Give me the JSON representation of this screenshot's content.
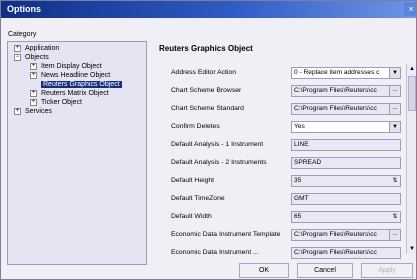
{
  "window": {
    "title": "Options",
    "close_label": "×"
  },
  "category": {
    "label": "Category",
    "tree": [
      {
        "label": "Application",
        "expander": "+"
      },
      {
        "label": "Objects",
        "expander": "−"
      },
      {
        "label": "Item Display Object",
        "expander": "+"
      },
      {
        "label": "News Headline Object",
        "expander": "+"
      },
      {
        "label": "Reuters Graphics Object",
        "selected": true
      },
      {
        "label": "Reuters Matrix Object",
        "expander": "+"
      },
      {
        "label": "Ticker Object",
        "expander": "+"
      },
      {
        "label": "Services",
        "expander": "+"
      }
    ]
  },
  "panel": {
    "title": "Reuters Graphics Object",
    "rows": [
      {
        "label": "Address Editor Action",
        "value": "0 - Replace item addresses c",
        "control": "dropdown"
      },
      {
        "label": "Chart Scheme Browser",
        "value": "C:\\Program Files\\Reuters\\cc",
        "control": "browse"
      },
      {
        "label": "Chart Scheme Standard",
        "value": "C:\\Program Files\\Reuters\\cc",
        "control": "browse"
      },
      {
        "label": "Confirm Deletes",
        "value": "Yes",
        "control": "dropdown"
      },
      {
        "label": "Default Analysis - 1 Instrument",
        "value": "LINE",
        "control": "text"
      },
      {
        "label": "Default Analysis - 2 Instruments",
        "value": "SPREAD",
        "control": "text"
      },
      {
        "label": "Default Height",
        "value": "35",
        "control": "spin"
      },
      {
        "label": "Default TimeZone",
        "value": "GMT",
        "control": "text"
      },
      {
        "label": "Default Width",
        "value": "65",
        "control": "spin"
      },
      {
        "label": "Economic Data Instrument Template",
        "value": "C:\\Program Files\\Reuters\\cc",
        "control": "browse"
      },
      {
        "label": "Economic Data Instrument ...",
        "value": "C:\\Program Files\\Reuters\\cc",
        "control": "browse"
      }
    ]
  },
  "buttons": {
    "ok": "OK",
    "cancel": "Cancel",
    "apply": "Apply"
  },
  "icons": {
    "dropdown": "▼",
    "browse": "...",
    "spin": "⇅",
    "scroll_up": "▲",
    "scroll_down": "▼"
  }
}
